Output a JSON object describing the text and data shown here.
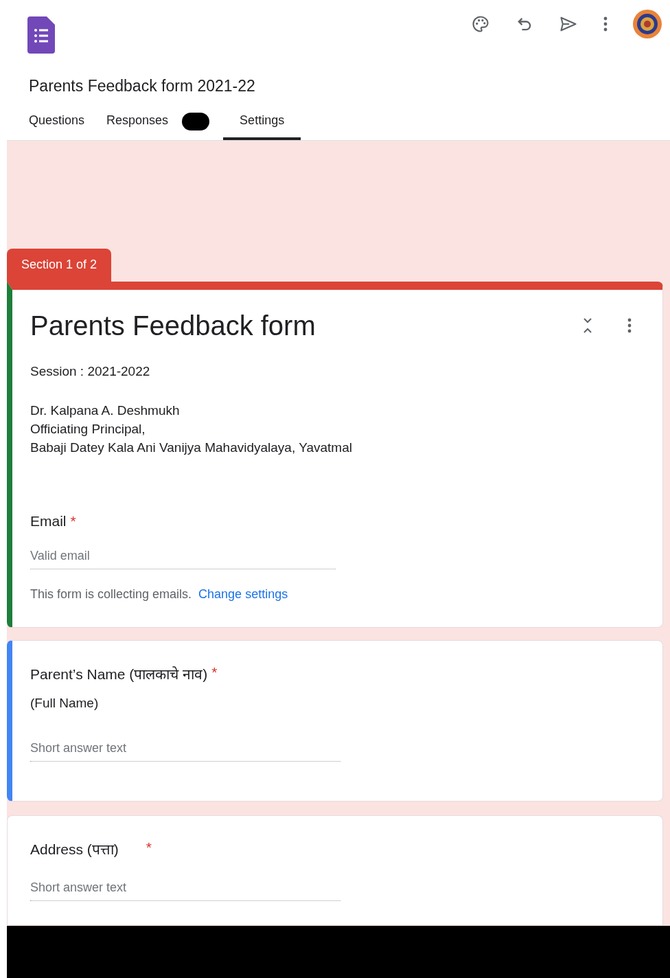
{
  "form_title": "Parents Feedback form 2021-22",
  "tabs": [
    {
      "label": "Questions",
      "selected": false,
      "badge_redacted": false
    },
    {
      "label": "Responses",
      "selected": false,
      "badge_redacted": true
    },
    {
      "label": "Settings",
      "selected": true,
      "badge_redacted": false
    }
  ],
  "section_tab": "Section 1 of 2",
  "header_card": {
    "title": "Parents Feedback form",
    "description": [
      "Session : 2021-2022",
      "Dr. Kalpana A. Deshmukh\nOfficiating Principal,\nBabaji Datey Kala Ani Vanijya Mahavidyalaya, Yavatmal"
    ],
    "email": {
      "label": "Email",
      "required": true,
      "required_mark": "*",
      "placeholder": "Valid email",
      "note": "This form is collecting emails.",
      "link": "Change settings"
    }
  },
  "questions": [
    {
      "title": "Parent’s Name (पालकाचे नाव)",
      "subtitle": "(Full Name)",
      "required": true,
      "required_mark": "*",
      "placeholder": "Short answer text",
      "selected": true
    },
    {
      "title": "Address (पत्ता)",
      "required": true,
      "required_mark": "*",
      "placeholder": "Short answer text",
      "selected": false
    }
  ]
}
